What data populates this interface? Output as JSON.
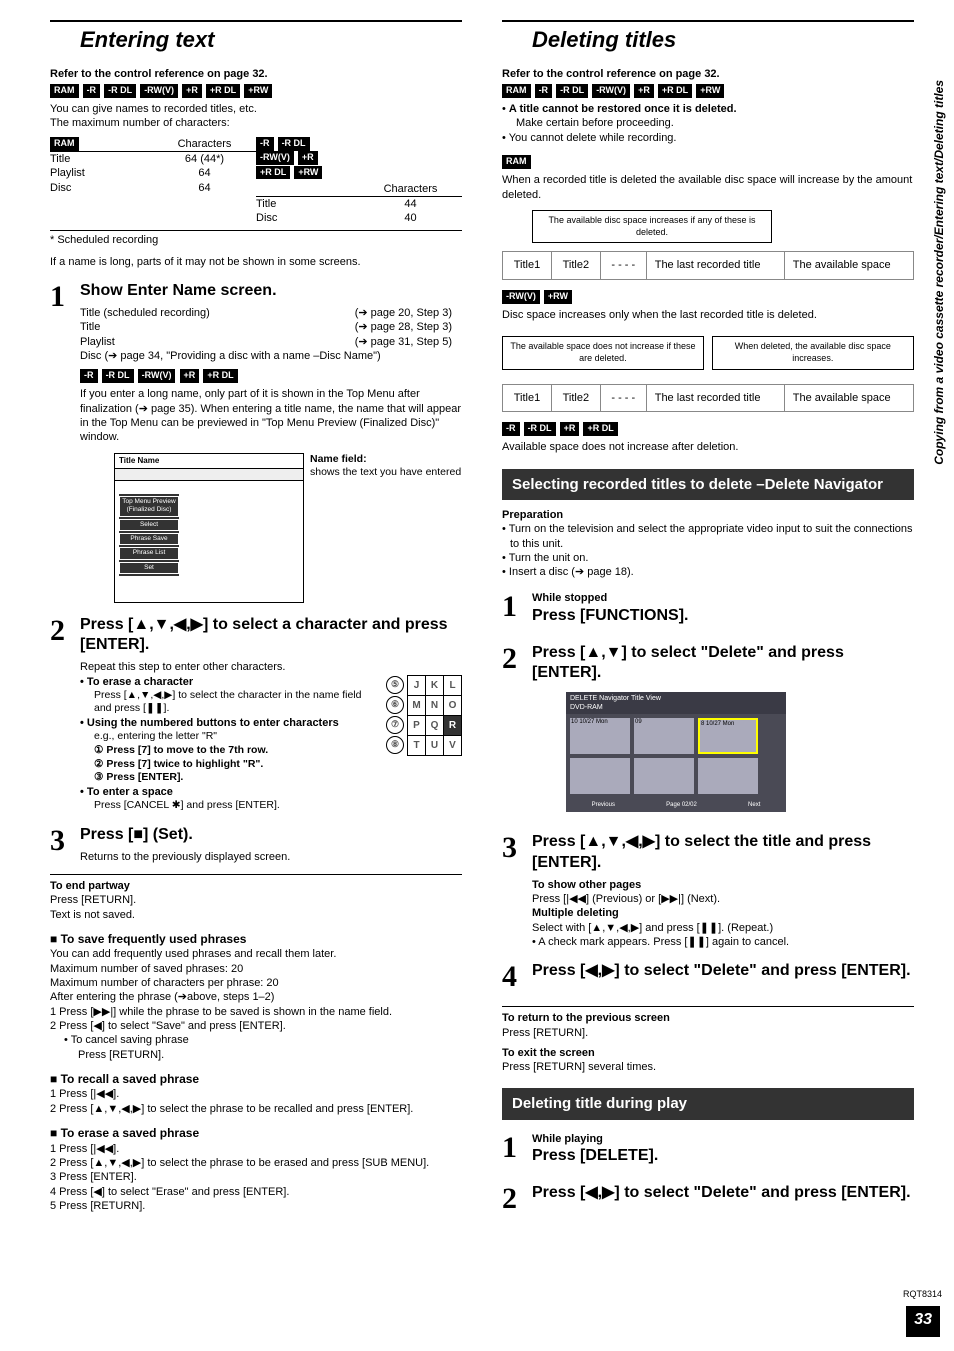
{
  "side_label": "Copying from a video cassette recorder/Entering text/Deleting titles",
  "doc_id": "RQT8314",
  "page_num": "33",
  "left": {
    "title": "Entering text",
    "ref": "Refer to the control reference on page 32.",
    "badges1": [
      "RAM",
      "-R",
      "-R DL",
      "-RW(V)",
      "+R",
      "+R DL",
      "+RW"
    ],
    "intro1": "You can give names to recorded titles, etc.",
    "intro2": "The maximum number of characters:",
    "table_left_header_badge": "RAM",
    "table_header_chars": "Characters",
    "table_right_header_badges": [
      "-R",
      "-R DL",
      "-RW(V)",
      "+R",
      "+R DL",
      "+RW"
    ],
    "table_left_rows": [
      {
        "k": "Title",
        "v": "64 (44*)"
      },
      {
        "k": "Playlist",
        "v": "64"
      },
      {
        "k": "Disc",
        "v": "64"
      }
    ],
    "table_right_rows": [
      {
        "k": "Title",
        "v": "44"
      },
      {
        "k": "Disc",
        "v": "40"
      }
    ],
    "foot_star": "* Scheduled recording",
    "note1": "If a name is long, parts of it may not be shown in some screens.",
    "step1_title": "Show Enter Name screen.",
    "step1_rows": [
      {
        "k": "Title (scheduled recording)",
        "v": "(➔ page 20, Step 3)"
      },
      {
        "k": "Title",
        "v": "(➔ page 28, Step 3)"
      },
      {
        "k": "Playlist",
        "v": "(➔ page 31, Step 5)"
      },
      {
        "k": "Disc",
        "v": "(➔ page 34, \"Providing a disc with a name –Disc Name\")"
      }
    ],
    "step1_badges": [
      "-R",
      "-R DL",
      "-RW(V)",
      "+R",
      "+R DL"
    ],
    "step1_para": "If you enter a long name, only part of it is shown in the Top Menu after finalization (➔ page 35). When entering a title name, the name that will appear in the Top Menu can be previewed in \"Top Menu Preview (Finalized Disc)\" window.",
    "title_diagram_header": "Title Name",
    "title_diagram_items": [
      "Top Menu Preview (Finalized Disc)",
      "Select",
      "Phrase Save",
      "Phrase List",
      "Set"
    ],
    "name_field_head": "Name field:",
    "name_field_text": "shows the text you have entered",
    "step2_title": "Press [▲,▼,◀,▶] to select a character and press [ENTER].",
    "step2_l1": "Repeat this step to enter other characters.",
    "step2_b1": "To erase a character",
    "step2_b1t": "Press [▲,▼,◀,▶] to select the character in the name field and press [❚❚].",
    "step2_b2": "Using the numbered buttons to enter characters",
    "step2_b2t": "e.g., entering the letter \"R\"",
    "step2_b2_1": "① Press [7] to move to the 7th row.",
    "step2_b2_2": "② Press [7] twice to highlight \"R\".",
    "step2_b2_3": "③ Press [ENTER].",
    "step2_b3": "To enter a space",
    "step2_b3t": "Press [CANCEL ✱] and press [ENTER].",
    "key_rows": [
      [
        "⑤",
        "J",
        "K",
        "L"
      ],
      [
        "⑥",
        "M",
        "N",
        "O"
      ],
      [
        "⑦",
        "P",
        "Q",
        "R"
      ],
      [
        "⑧",
        "T",
        "U",
        "V"
      ]
    ],
    "step3_title": "Press [■] (Set).",
    "step3_l1": "Returns to the previously displayed screen.",
    "end_partway": "To end partway",
    "end_p1": "Press [RETURN].",
    "end_p2": "Text is not saved.",
    "save_head": "To save frequently used phrases",
    "save_p1": "You can add frequently used phrases and recall them later.",
    "save_p2": "Maximum number of saved phrases: 20",
    "save_p3": "Maximum number of characters per phrase: 20",
    "save_p4": "After entering the phrase (➔above, steps 1–2)",
    "save_li1": "1   Press [▶▶|] while the phrase to be saved is shown in the name field.",
    "save_li2": "2   Press [◀] to select \"Save\" and press [ENTER].",
    "save_li2b": "• To cancel saving phrase",
    "save_li2c": "Press [RETURN].",
    "recall_head": "To recall a saved phrase",
    "recall_li1": "1   Press [|◀◀].",
    "recall_li2": "2   Press [▲,▼,◀,▶] to select the phrase to be recalled and press [ENTER].",
    "erase_head": "To erase a saved phrase",
    "erase_li1": "1   Press [|◀◀].",
    "erase_li2": "2   Press [▲,▼,◀,▶] to select the phrase to be erased and press [SUB MENU].",
    "erase_li3": "3   Press [ENTER].",
    "erase_li4": "4   Press [◀] to select \"Erase\" and press [ENTER].",
    "erase_li5": "5   Press [RETURN]."
  },
  "right": {
    "title": "Deleting titles",
    "ref": "Refer to the control reference on page 32.",
    "badges1": [
      "RAM",
      "-R",
      "-R DL",
      "-RW(V)",
      "+R",
      "+R DL",
      "+RW"
    ],
    "b1": "A title cannot be restored once it is deleted.",
    "b1t": "Make certain before proceeding.",
    "b2": "You cannot delete while recording.",
    "ram_badge": "RAM",
    "ram_p": "When a recorded title is deleted the available disc space will increase by the amount deleted.",
    "callout1": "The available disc space increases if any of these is deleted.",
    "box_table": [
      "Title1",
      "Title2",
      "- - - -",
      "The last recorded title",
      "The available space"
    ],
    "badges2": [
      "-RW(V)",
      "+RW"
    ],
    "p2": "Disc space increases only when the last recorded title is deleted.",
    "callout2a": "The available space does not increase if these are deleted.",
    "callout2b": "When deleted, the available disc space increases.",
    "badges3": [
      "-R",
      "-R DL",
      "+R",
      "+R DL"
    ],
    "p3": "Available space does not increase after deletion.",
    "sel_title": "Selecting recorded titles to delete –Delete Navigator",
    "prep": "Preparation",
    "prep1": "Turn on the television and select the appropriate video input to suit the connections to this unit.",
    "prep2": "Turn the unit on.",
    "prep3": "Insert a disc (➔ page 18).",
    "s1_pre": "While stopped",
    "s1": "Press [FUNCTIONS].",
    "s2": "Press [▲,▼] to select \"Delete\" and press [ENTER].",
    "nav_header": "DELETE Navigator   Title View",
    "nav_sub": "DVD-RAM",
    "nav_thumb1": "10 10/27 Mon",
    "nav_thumb2": "09",
    "nav_thumb3": "8  10/27 Mon",
    "nav_prev": "Previous",
    "nav_page": "Page   02/02",
    "nav_next": "Next",
    "s3": "Press [▲,▼,◀,▶] to select the title and press [ENTER].",
    "s3_h1": "To show other pages",
    "s3_t1": "Press [|◀◀] (Previous) or [▶▶|] (Next).",
    "s3_h2": "Multiple deleting",
    "s3_t2": "Select with [▲,▼,◀,▶] and press [❚❚]. (Repeat.)",
    "s3_t3": "• A check mark appears. Press [❚❚] again to cancel.",
    "s4": "Press [◀,▶] to select \"Delete\" and press [ENTER].",
    "ret_h": "To return to the previous screen",
    "ret_t": "Press [RETURN].",
    "exit_h": "To exit the screen",
    "exit_t": "Press [RETURN] several times.",
    "play_title": "Deleting title during play",
    "p_s1_pre": "While playing",
    "p_s1": "Press [DELETE].",
    "p_s2": "Press [◀,▶] to select \"Delete\" and press [ENTER]."
  }
}
